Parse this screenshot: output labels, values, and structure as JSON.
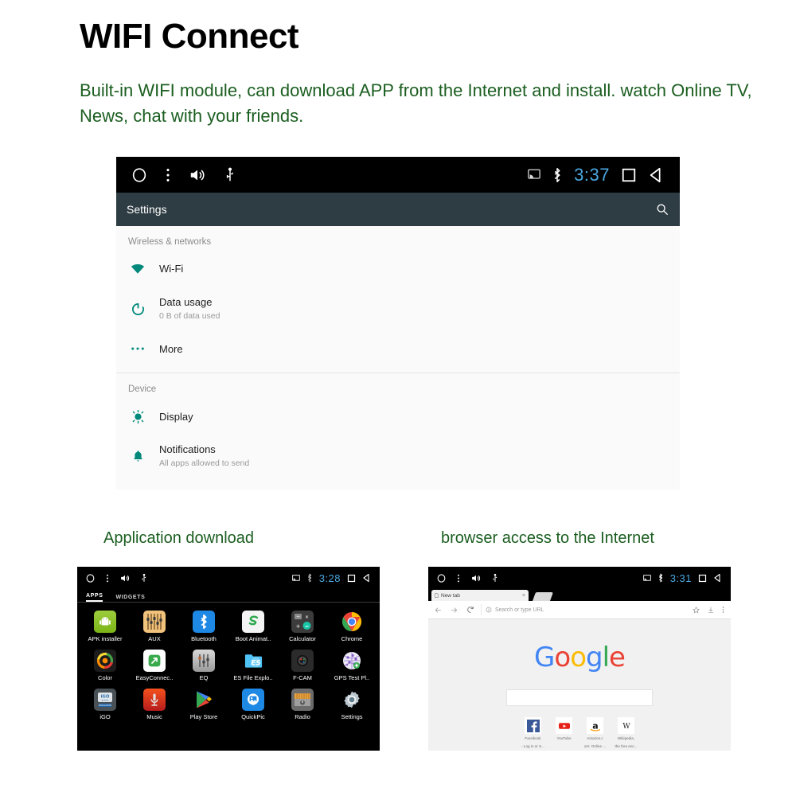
{
  "header": {
    "title": "WIFI Connect",
    "subtitle": "Built-in WIFI module, can download APP from the Internet and install. watch Online TV, News, chat with your friends.",
    "title_color": "#000000",
    "text_color": "#1b5e20"
  },
  "captions": {
    "apps": "Application download",
    "browser": "browser access to the Internet"
  },
  "settings_screen": {
    "statusbar": {
      "time": "3:37",
      "time_color": "#4aa8e0",
      "left_icons": [
        "home-circle-icon",
        "overflow-menu-icon",
        "volume-icon",
        "usb-icon"
      ],
      "right_icons": [
        "cast-icon",
        "bluetooth-icon",
        "recents-square-icon",
        "back-triangle-icon"
      ]
    },
    "actionbar": {
      "title": "Settings",
      "bg": "#2e3c43",
      "search_icon": "search-icon"
    },
    "accent": "#00897b",
    "sections": [
      {
        "header": "Wireless & networks",
        "items": [
          {
            "icon": "wifi-icon",
            "title": "Wi-Fi",
            "subtitle": ""
          },
          {
            "icon": "data-usage-icon",
            "title": "Data usage",
            "subtitle": "0 B of data used"
          },
          {
            "icon": "more-dots-icon",
            "title": "More",
            "subtitle": ""
          }
        ]
      },
      {
        "header": "Device",
        "items": [
          {
            "icon": "display-brightness-icon",
            "title": "Display",
            "subtitle": ""
          },
          {
            "icon": "notifications-bell-icon",
            "title": "Notifications",
            "subtitle": "All apps allowed to send"
          }
        ]
      }
    ]
  },
  "app_drawer": {
    "statusbar": {
      "time": "3:28",
      "time_color": "#4aa8e0"
    },
    "tabs": [
      {
        "label": "APPS",
        "active": true
      },
      {
        "label": "WIDGETS",
        "active": false
      }
    ],
    "apps": [
      {
        "label": "APK installer",
        "icon": "android-robot-icon"
      },
      {
        "label": "AUX",
        "icon": "aux-mixer-icon"
      },
      {
        "label": "Bluetooth",
        "icon": "bluetooth-icon"
      },
      {
        "label": "Boot Animat..",
        "icon": "boot-animation-icon"
      },
      {
        "label": "Calculator",
        "icon": "calculator-icon"
      },
      {
        "label": "Chrome",
        "icon": "chrome-icon"
      },
      {
        "label": "Color",
        "icon": "color-wheel-icon"
      },
      {
        "label": "EasyConnec..",
        "icon": "easyconnect-icon"
      },
      {
        "label": "EQ",
        "icon": "equalizer-icon"
      },
      {
        "label": "ES File Explo..",
        "icon": "es-file-explorer-icon"
      },
      {
        "label": "F-CAM",
        "icon": "camera-icon"
      },
      {
        "label": "GPS Test Pl..",
        "icon": "gps-test-icon"
      },
      {
        "label": "iGO",
        "icon": "igo-navigation-icon"
      },
      {
        "label": "Music",
        "icon": "music-icon"
      },
      {
        "label": "Play Store",
        "icon": "play-store-icon"
      },
      {
        "label": "QuickPic",
        "icon": "quickpic-icon"
      },
      {
        "label": "Radio",
        "icon": "radio-icon"
      },
      {
        "label": "Settings",
        "icon": "settings-gear-icon"
      }
    ]
  },
  "browser": {
    "statusbar": {
      "time": "3:31",
      "time_color": "#4aa8e0"
    },
    "tab": {
      "title": "New tab",
      "close": "×"
    },
    "omnibox": {
      "placeholder": "Search or type URL",
      "value": ""
    },
    "toolbar_icons": [
      "back-arrow-icon",
      "forward-arrow-icon",
      "reload-icon",
      "page-info-icon",
      "bookmark-star-icon",
      "download-icon",
      "browser-menu-icon"
    ],
    "logo": {
      "letters": [
        "G",
        "o",
        "o",
        "g",
        "l",
        "e"
      ]
    },
    "search_box_value": "",
    "shortcuts": [
      {
        "icon": "facebook-icon",
        "line1": "Facebook",
        "line2": "- Log in or S..."
      },
      {
        "icon": "youtube-icon",
        "line1": "YouTube",
        "line2": ""
      },
      {
        "icon": "amazon-icon",
        "line1": "Amazon.c",
        "line2": "om: Online ..."
      },
      {
        "icon": "wikipedia-icon",
        "line1": "Wikipedia,",
        "line2": "the free enc..."
      }
    ]
  }
}
